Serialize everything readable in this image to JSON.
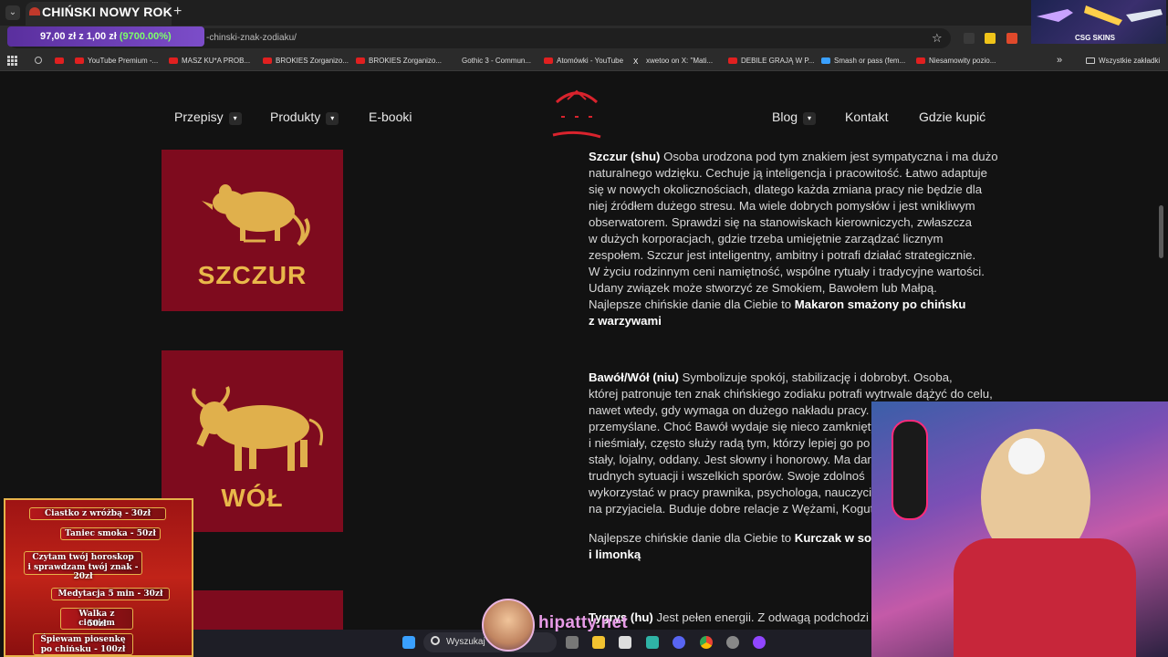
{
  "browser": {
    "tab_title": "CHIŃSKI NOWY ROK",
    "new_tab": "+",
    "url": "-chinski-znak-zodiaku/",
    "price_badge": {
      "main": "97,00 zł z 1,00 zł",
      "pct": "(9700.00%)"
    },
    "bookmarks": [
      "YouTube Premium -...",
      "MASZ KU*A PROB...",
      "BROKIES Zorganizo...",
      "BROKIES Zorganizo...",
      "Gothic 3 - Commun...",
      "Atomówki - YouTube",
      "xwetoo on X: \"Mati...",
      "DEBILE GRAJĄ W P...",
      "Smash or pass (fem...",
      "Niesamowity pozio..."
    ],
    "bookmarks_more": "»",
    "all_bookmarks": "Wszystkie zakładki",
    "extension_label": "CSG SKINS"
  },
  "site_nav": {
    "left": [
      {
        "label": "Przepisy",
        "caret": true
      },
      {
        "label": "Produkty",
        "caret": true
      },
      {
        "label": "E-booki",
        "caret": false
      }
    ],
    "right": [
      {
        "label": "Blog",
        "caret": true
      },
      {
        "label": "Kontakt",
        "caret": false
      },
      {
        "label": "Gdzie kupić",
        "caret": false
      }
    ],
    "caret_icon": "chevron-down-icon",
    "colors": {
      "accent_red": "#d9232d",
      "card_red": "#7e0b1e",
      "gold": "#e9b84a"
    }
  },
  "cards": [
    {
      "name": "SZCZUR",
      "icon": "rat-icon"
    },
    {
      "name": "WÓŁ",
      "icon": "ox-icon"
    }
  ],
  "entries": [
    {
      "title": "Szczur (shu)",
      "lines": [
        "Osoba urodzona pod tym znakiem jest sympatyczna i ma dużo",
        "naturalnego wdzięku. Cechuje ją inteligencja i pracowitość. Łatwo adaptuje",
        "się w nowych okolicznościach, dlatego każda zmiana pracy nie będzie dla",
        "niej źródłem dużego stresu. Ma wiele dobrych pomysłów i jest wnikliwym",
        "obserwatorem. Sprawdzi się na stanowiskach kierowniczych, zwłaszcza",
        "w dużych korporacjach, gdzie trzeba umiejętnie zarządzać licznym",
        "zespołem. Szczur jest inteligentny, ambitny i potrafi działać strategicznie.",
        "W życiu rodzinnym ceni namiętność, wspólne rytuały i tradycyjne wartości.",
        "Udany związek może stworzyć ze Smokiem, Bawołem lub Małpą."
      ],
      "dish_intro": "Najlepsze chińskie danie dla Ciebie to",
      "dish_line1": "Makaron smażony po chińsku",
      "dish_line2": "z warzywami"
    },
    {
      "title": "Bawół/Wół (niu)",
      "lines": [
        "Symbolizuje spokój, stabilizację i dobrobyt. Osoba,",
        "której patronuje ten znak chińskiego zodiaku potrafi wytrwale dążyć do celu,",
        "nawet wtedy, gdy wymaga on dużego nakładu pracy.",
        "przemyślane. Choć Bawół wydaje się nieco zamknięty",
        "i nieśmiały, często służy radą tym, którzy lepiej go po",
        "stały, lojalny, oddany. Jest słowny i honorowy. Ma dar",
        "trudnych sytuacji i wszelkich sporów. Swoje zdolnoś",
        "wykorzystać w pracy prawnika, psychologa, nauczyci",
        "na przyjaciela. Buduje dobre relacje z Wężami, Koguta"
      ],
      "dish_intro": "Najlepsze chińskie danie dla Ciebie to",
      "dish_line1": "Kurczak w sos",
      "dish_line2": "i limonką"
    },
    {
      "title": "Tygrys (hu)",
      "first_line": "Jest pełen energii. Z odwagą podchodzi"
    }
  ],
  "stream_menu": [
    "Ciastko z wróżbą - 30zł",
    "Taniec smoka - 50zł",
    "Czytam twój horoskop",
    "i sprawdzam twój znak - 20zł",
    "Medytacja 5 min - 30zł",
    "Walka z cieniem",
    "50zł",
    "Śpiewam piosenkę",
    "po chińsku - 100zł"
  ],
  "taskbar": {
    "search_label": "Wyszukaj",
    "streamer": "hipatty.net"
  }
}
